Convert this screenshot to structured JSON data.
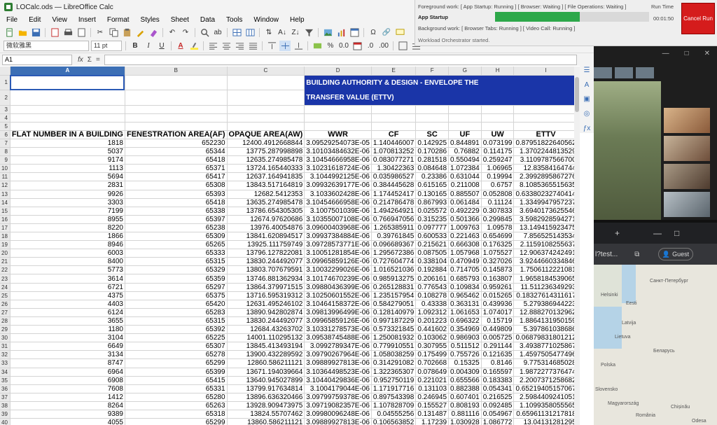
{
  "window": {
    "title": "LOCalc.ods — LibreOffice Calc"
  },
  "menu": [
    "File",
    "Edit",
    "View",
    "Insert",
    "Format",
    "Styles",
    "Sheet",
    "Data",
    "Tools",
    "Window",
    "Help"
  ],
  "toolbar": {
    "font_name": "微软雅黑",
    "font_size": "11 pt"
  },
  "formula_bar": {
    "cell_ref": "A1",
    "fx": "fx",
    "sigma": "Σ",
    "equals": "="
  },
  "columns": [
    "A",
    "B",
    "C",
    "D",
    "E",
    "F",
    "G",
    "H",
    "I"
  ],
  "banner": {
    "line1": "BUILDING AUTHORITY & DESIGN - ENVELOPE THE",
    "line2": "TRANSFER VALUE (ETTV)"
  },
  "headers": [
    "FLAT NUMBER IN A BUILDING",
    "FENESTRATION AREA(AF)",
    "OPAQUE AREA(AW)",
    "WWR",
    "CF",
    "SC",
    "UF",
    "UW",
    "ETTV"
  ],
  "rows": [
    [
      "1818",
      "652230",
      "12400.4912668844",
      "3.09529254073E-05",
      "1.140446007",
      "0.142925",
      "0.844891",
      "0.073199",
      "0.87951822640562"
    ],
    [
      "5037",
      "65344",
      "13775.287998898",
      "3.10103484632E-06",
      "1.070813252",
      "0.170286",
      "0.76882",
      "0.114175",
      "1.3702244813529"
    ],
    [
      "9174",
      "65418",
      "12635.274985478",
      "3.10454666958E-06",
      "0.083077271",
      "0.281518",
      "0.550494",
      "0.259247",
      "3.1109787566700"
    ],
    [
      "1113",
      "65371",
      "13724.165440333",
      "3.10231618724E-06",
      "1.30422363",
      "0.084648",
      "1.072384",
      "1.06965",
      "12.83584164744"
    ],
    [
      "5694",
      "65417",
      "12637.164941835",
      "3.1044992125E-06",
      "0.035986527",
      "0.23386",
      "0.631044",
      "0.19994",
      "2.3992895867276"
    ],
    [
      "2831",
      "65308",
      "13843.517164819",
      "3.09932639177E-06",
      "0.384445628",
      "0.615165",
      "0.211008",
      "0.6757",
      "8.1085365515635"
    ],
    [
      "9926",
      "65393",
      "12682.5412353",
      "3.1033602428E-06",
      "1.174452417",
      "0.130165",
      "0.885507",
      "0.052808",
      "0.63380232740414"
    ],
    [
      "3303",
      "65418",
      "13635.274985478",
      "3.10454666958E-06",
      "0.214786478",
      "0.867993",
      "0.061484",
      "0.11124",
      "1.3349947957237"
    ],
    [
      "7199",
      "65338",
      "13786.654305305",
      "3.1007501039E-06",
      "1.494264921",
      "0.025572",
      "0.492229",
      "0.307833",
      "3.6940173625546"
    ],
    [
      "8955",
      "65397",
      "12674.97620686",
      "3.10355007108E-06",
      "0.766947056",
      "0.315235",
      "0.501366",
      "0.299845",
      "3.5982928594271"
    ],
    [
      "8220",
      "65238",
      "13976.40054876",
      "3.09600403968E-06",
      "1.265385911",
      "0.097777",
      "1.009763",
      "1.09578",
      "13.149415923475"
    ],
    [
      "1866",
      "65309",
      "13841.620894517",
      "3.09937384884E-06",
      "0.39761845",
      "0.600533",
      "0.221463",
      "0.654699",
      "7.856525143534"
    ],
    [
      "8946",
      "65265",
      "13925.111759749",
      "3.09728573771E-06",
      "0.096689367",
      "0.215621",
      "0.666308",
      "0.176325",
      "2.1159108255637"
    ],
    [
      "6003",
      "65333",
      "13796.127822081",
      "3.10051281854E-06",
      "1.295672386",
      "0.087505",
      "1.057968",
      "1.075527",
      "12.906374242491"
    ],
    [
      "8400",
      "65315",
      "13830.244492077",
      "3.09965859126E-06",
      "0.727604774",
      "0.338104",
      "0.470949",
      "0.327026",
      "3.9244660334846"
    ],
    [
      "5773",
      "65329",
      "13803.707679591",
      "3.10032299026E-06",
      "1.016521036",
      "0.192884",
      "0.714705",
      "0.145873",
      "1.7506112221081"
    ],
    [
      "3614",
      "65359",
      "13746.881362934",
      "3.10174670239E-06",
      "0.985913275",
      "0.206161",
      "0.685793",
      "0.163807",
      "1.9658184539065"
    ],
    [
      "6721",
      "65297",
      "13864.379971515",
      "3.09880436399E-06",
      "0.265128831",
      "0.776543",
      "0.109834",
      "0.959261",
      "11.511236349293"
    ],
    [
      "4375",
      "65375",
      "13716.595319312",
      "3.10250601552E-06",
      "1.235157954",
      "0.108278",
      "0.965462",
      "0.015265",
      "0.18327614311617"
    ],
    [
      "4403",
      "65420",
      "12631.495246102",
      "3.10464158372E-06",
      "0.584279051",
      "0.43338",
      "0.363131",
      "0.439936",
      "5.279386944223"
    ],
    [
      "6124",
      "65283",
      "13890.942802874",
      "3.09813996499E-06",
      "0.128140979",
      "1.092312",
      "1.061653",
      "1.074017",
      "12.888270132962"
    ],
    [
      "3655",
      "65315",
      "13830.244492077",
      "3.09965859126E-06",
      "0.997187229",
      "0.201223",
      "0.696322",
      "0.15719",
      "1.8864131950159"
    ],
    [
      "1180",
      "65392",
      "12684.43263702",
      "3.10331278573E-06",
      "0.573321845",
      "0.441602",
      "0.354969",
      "0.449809",
      "5.397861038686"
    ],
    [
      "3104",
      "65225",
      "14001.110295132",
      "3.09538745488E-06",
      "1.250081932",
      "0.103062",
      "0.986903",
      "0.005725",
      "0.06879831801212"
    ],
    [
      "6649",
      "65307",
      "13845.413493194",
      "3.0992789347E-06",
      "0.779910551",
      "0.307955",
      "0.511512",
      "0.291144",
      "3.4938771025867"
    ],
    [
      "3134",
      "65278",
      "13900.432289592",
      "3.09790267964E-06",
      "1.058038259",
      "0.175499",
      "0.755726",
      "0.121635",
      "1.4597505477496"
    ],
    [
      "8747",
      "65299",
      "12860.586211121",
      "3.09889927813E-06",
      "0.314291082",
      "0.702668",
      "0.15325",
      "0.8146",
      "9.775314685028"
    ],
    [
      "6964",
      "65399",
      "13671.194039664",
      "3.10364498523E-06",
      "1.322365307",
      "0.078649",
      "0.004309",
      "0.165597",
      "1.9872277376474"
    ],
    [
      "6908",
      "65415",
      "13640.945027899",
      "3.10440429836E-06",
      "0.952750119",
      "0.221021",
      "0.655566",
      "0.183383",
      "2.2007371258682"
    ],
    [
      "7608",
      "65331",
      "13799.917634814",
      "3.1004179044E-06",
      "1.171917716",
      "0.131103",
      "0.882388",
      "0.054341",
      "0.65219405157067"
    ],
    [
      "1412",
      "65280",
      "13896.636320466",
      "3.09799759378E-06",
      "0.897543398",
      "0.246945",
      "0.607401",
      "0.216525",
      "2.5984409241051"
    ],
    [
      "8264",
      "65263",
      "13928.909473975",
      "3.09719082357E-06",
      "1.107828709",
      "0.155527",
      "0.808193",
      "0.092485",
      "1.1099358055565"
    ],
    [
      "9389",
      "65318",
      "13824.55707462",
      "3.09980096248E-06",
      "0.04555256",
      "0.131487",
      "0.881116",
      "0.054967",
      "0.65961131217818"
    ],
    [
      "4055",
      "65299",
      "13860.586211121",
      "3.09889927813E-06",
      "0.106563852",
      "1.17239",
      "1.030928",
      "1.086772",
      "13.04131281295"
    ]
  ],
  "orchestrator": {
    "foreground": "Foreground work: [ App Startup: Running ] [ Browser: Waiting ] [ File Operations: Waiting ]",
    "app_startup": "App Startup",
    "progress": 0.55,
    "background": "Background work: [ Browser Tabs: Running ] [ Video Call: Running ]",
    "status": "Workload Orchestrator started.",
    "run_time_label": "Run Time",
    "run_time": "00:01:50",
    "cancel": "Cancel Run"
  },
  "browser": {
    "url": "l?test...",
    "guest": "Guest",
    "map_labels": [
      "Санкт-Петербург",
      "Helsinki",
      "Eesti",
      "Latvija",
      "Lietuva",
      "Беларусь",
      "Polska",
      "Slovensko",
      "Magyarország",
      "România",
      "Chișinău",
      "Odesa"
    ]
  },
  "colors": {
    "banner_bg": "#1a35a8",
    "cancel_bg": "#d51c1c",
    "progress": "#2da84a"
  }
}
